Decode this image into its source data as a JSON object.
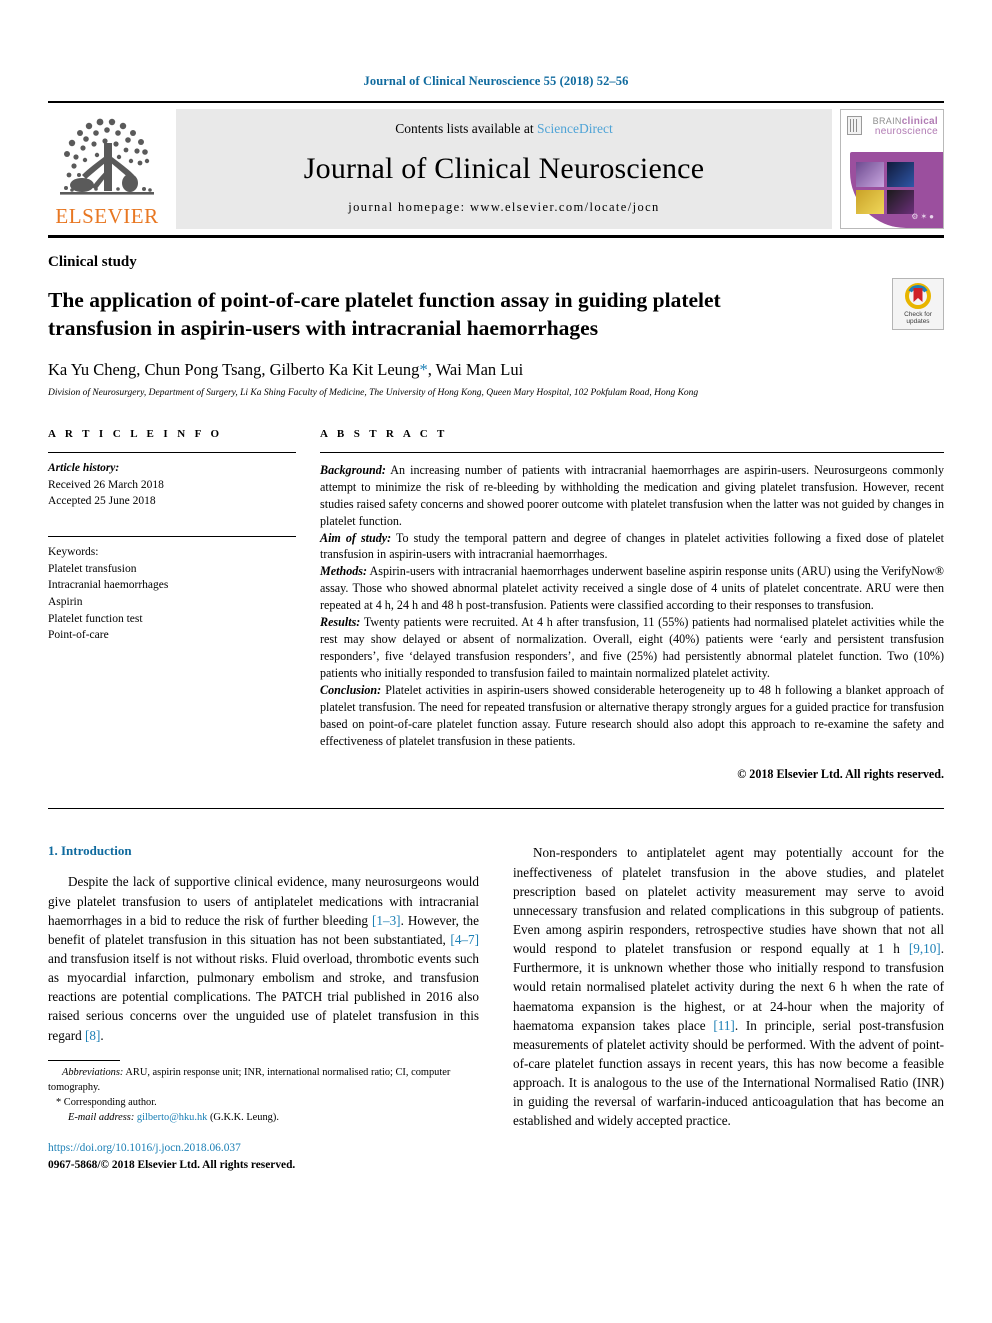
{
  "running_head": "Journal of Clinical Neuroscience 55 (2018) 52–56",
  "masthead": {
    "contents_prefix": "Contents lists available at ",
    "sciencedirect": "ScienceDirect",
    "journal_title": "Journal of Clinical Neuroscience",
    "homepage": "journal homepage: www.elsevier.com/locate/jocn",
    "publisher": "ELSEVIER",
    "cover": {
      "line1_small": "BRAIN",
      "line1_big": "clinical",
      "line2": "neuroscience"
    }
  },
  "article": {
    "kicker": "Clinical study",
    "title": "The application of point-of-care platelet function assay in guiding platelet transfusion in aspirin-users with intracranial haemorrhages",
    "authors": "Ka Yu Cheng, Chun Pong Tsang, Gilberto Ka Kit Leung",
    "authors_tail": ", Wai Man Lui",
    "corresponding_mark": "*",
    "affiliation": "Division of Neurosurgery, Department of Surgery, Li Ka Shing Faculty of Medicine, The University of Hong Kong, Queen Mary Hospital, 102 Pokfulam Road, Hong Kong",
    "crossmark_label": "Check for updates"
  },
  "article_info": {
    "heading": "A R T I C L E   I N F O",
    "history_label": "Article history:",
    "received": "Received 26 March 2018",
    "accepted": "Accepted 25 June 2018",
    "keywords_label": "Keywords:",
    "keywords": [
      "Platelet transfusion",
      "Intracranial haemorrhages",
      "Aspirin",
      "Platelet function test",
      "Point-of-care"
    ]
  },
  "abstract": {
    "heading": "A B S T R A C T",
    "sections": [
      {
        "label": "Background:",
        "text": " An increasing number of patients with intracranial haemorrhages are aspirin-users. Neurosurgeons commonly attempt to minimize the risk of re-bleeding by withholding the medication and giving platelet transfusion. However, recent studies raised safety concerns and showed poorer outcome with platelet transfusion when the latter was not guided by changes in platelet function."
      },
      {
        "label": "Aim of study:",
        "text": " To study the temporal pattern and degree of changes in platelet activities following a fixed dose of platelet transfusion in aspirin-users with intracranial haemorrhages."
      },
      {
        "label": "Methods:",
        "text": " Aspirin-users with intracranial haemorrhages underwent baseline aspirin response units (ARU) using the VerifyNow® assay. Those who showed abnormal platelet activity received a single dose of 4 units of platelet concentrate. ARU were then repeated at 4 h, 24 h and 48 h post-transfusion. Patients were classified according to their responses to transfusion."
      },
      {
        "label": "Results:",
        "text": " Twenty patients were recruited. At 4 h after transfusion, 11 (55%) patients had normalised platelet activities while the rest may show delayed or absent of normalization. Overall, eight (40%) patients were ‘early and persistent transfusion responders’, five ‘delayed transfusion responders’, and five (25%) had persistently abnormal platelet function. Two (10%) patients who initially responded to transfusion failed to maintain normalized platelet activity."
      },
      {
        "label": "Conclusion:",
        "text": " Platelet activities in aspirin-users showed considerable heterogeneity up to 48 h following a blanket approach of platelet transfusion. The need for repeated transfusion or alternative therapy strongly argues for a guided practice for transfusion based on point-of-care platelet function assay. Future research should also adopt this approach to re-examine the safety and effectiveness of platelet transfusion in these patients."
      }
    ],
    "copyright": "© 2018 Elsevier Ltd. All rights reserved."
  },
  "body": {
    "section_number_title": "1. Introduction",
    "left_paragraph_1_a": "Despite the lack of supportive clinical evidence, many neurosurgeons would give platelet transfusion to users of antiplatelet medications with intracranial haemorrhages in a bid to reduce the risk of further bleeding ",
    "ref_1_3": "[1–3]",
    "left_paragraph_1_b": ". However, the benefit of platelet transfusion in this situation has not been substantiated, ",
    "ref_4_7": "[4–7]",
    "left_paragraph_1_c": " and transfusion itself is not without risks. Fluid overload, thrombotic events such as myocardial infarction, pulmonary embolism and stroke, and transfusion reactions are potential complications. The PATCH trial published in 2016 also raised serious concerns over the unguided use of platelet transfusion in this regard ",
    "ref_8": "[8]",
    "left_paragraph_1_d": ".",
    "right_paragraph_1_a": "Non-responders to antiplatelet agent may potentially account for the ineffectiveness of platelet transfusion in the above studies, and platelet prescription based on platelet activity measurement may serve to avoid unnecessary transfusion and related complications in this subgroup of patients. Even among aspirin responders, retrospective studies have shown that not all would respond to platelet transfusion or respond equally at 1 h ",
    "ref_9_10": "[9,10]",
    "right_paragraph_1_b": ". Furthermore, it is unknown whether those who initially respond to transfusion would retain normalised platelet activity during the next 6 h when the rate of haematoma expansion is the highest, or at 24-hour when the majority of haematoma expansion takes place ",
    "ref_11": "[11]",
    "right_paragraph_1_c": ". In principle, serial post-transfusion measurements of platelet activity should be performed. With the advent of point-of-care platelet function assays in recent years, this has now become a feasible approach. It is analogous to the use of the International Normalised Ratio (INR) in guiding the reversal of warfarin-induced anticoagulation that has become an established and widely accepted practice."
  },
  "footnotes": {
    "abbrev_label": "Abbreviations:",
    "abbrev_text": " ARU, aspirin response unit; INR, international normalised ratio; CI, computer tomography.",
    "corresponding": "* Corresponding author.",
    "email_label": "E-mail address:",
    "email": "gilberto@hku.hk",
    "email_suffix": " (G.K.K. Leung).",
    "doi": "https://doi.org/10.1016/j.jocn.2018.06.037",
    "issn_line_a": "0967-5868/",
    "issn_line_b": "© 2018 Elsevier Ltd. All rights reserved."
  },
  "colors": {
    "link": "#1b7fb5",
    "heading": "#0f6a9e",
    "elsevier_orange": "#e87722",
    "masthead_grey": "#e9e9e9"
  }
}
